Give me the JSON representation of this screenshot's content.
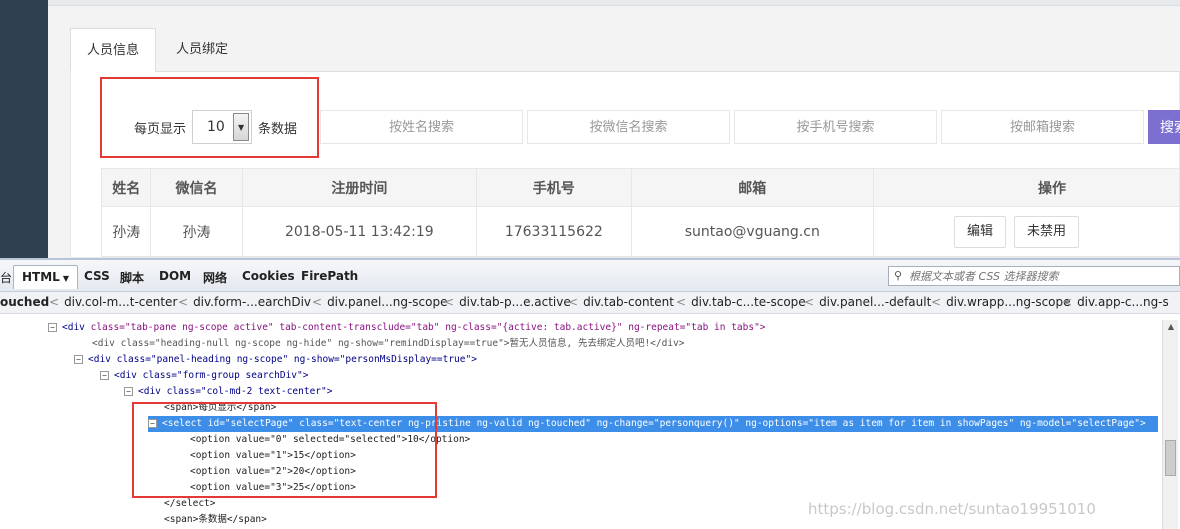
{
  "app": {
    "tabs": [
      {
        "label": "人员信息",
        "active": true
      },
      {
        "label": "人员绑定",
        "active": false
      }
    ],
    "page_size": {
      "prefix": "每页显示",
      "selected": "10",
      "suffix": "条数据"
    },
    "search": {
      "name_placeholder": "按姓名搜索",
      "wechat_placeholder": "按微信名搜索",
      "phone_placeholder": "按手机号搜索",
      "email_placeholder": "按邮箱搜索",
      "button_label": "搜索"
    },
    "table": {
      "headers": [
        "姓名",
        "微信名",
        "注册时间",
        "手机号",
        "邮箱",
        "操作"
      ],
      "rows": [
        {
          "name": "孙涛",
          "wechat": "孙涛",
          "registered": "2018-05-11 13:42:19",
          "phone": "17633115622",
          "email": "suntao@vguang.cn",
          "edit_label": "编辑",
          "ban_label": "未禁用"
        }
      ]
    },
    "colors": {
      "accent": "#7b6fd0",
      "sidebar": "#2f4050",
      "highlight": "#e53935"
    }
  },
  "devtools": {
    "tabs": {
      "console": "台",
      "html": "HTML",
      "css": "CSS",
      "script": "脚本",
      "dom": "DOM",
      "net": "网络",
      "cookies": "Cookies",
      "firepath": "FirePath"
    },
    "search_placeholder": "根据文本或者 CSS 选择器搜索",
    "breadcrumbs": [
      "ouched",
      "div.col-m...t-center",
      "div.form-...earchDiv",
      "div.panel...ng-scope",
      "div.tab-p...e.active",
      "div.tab-content",
      "div.tab-c...te-scope",
      "div.panel...-default",
      "div.wrapp...ng-scope",
      "div.app-c...ng-s"
    ],
    "code": {
      "line1_tag": "<div",
      "line1_attrs": " class=\"tab-pane ng-scope active\"  tab-content-transclude=\"tab\"  ng-class=\"{active: tab.active}\"  ng-repeat=\"tab in tabs\">",
      "line2": "<div  class=\"heading-null ng-scope ng-hide\"  ng-show=\"remindDisplay==true\">暂无人员信息, 先去绑定人员吧!</div>",
      "line3": "<div  class=\"panel-heading ng-scope\"  ng-show=\"personMsDisplay==true\">",
      "line4": "<div  class=\"form-group searchDiv\">",
      "line5": "<div  class=\"col-md-2 text-center\">",
      "line6": "<span>每页显示</span>",
      "line7": "<select  id=\"selectPage\"  class=\"text-center ng-pristine ng-valid ng-touched\"  ng-change=\"personquery()\"  ng-options=\"item as item for item in showPages\"  ng-model=\"selectPage\">",
      "options": [
        "<option  value=\"0\"  selected=\"selected\">10</option>",
        "<option  value=\"1\">15</option>",
        "<option  value=\"2\">20</option>",
        "<option  value=\"3\">25</option>"
      ],
      "line12": "</select>",
      "line13": "<span>条数据</span>"
    },
    "watermark": "https://blog.csdn.net/suntao19951010"
  }
}
